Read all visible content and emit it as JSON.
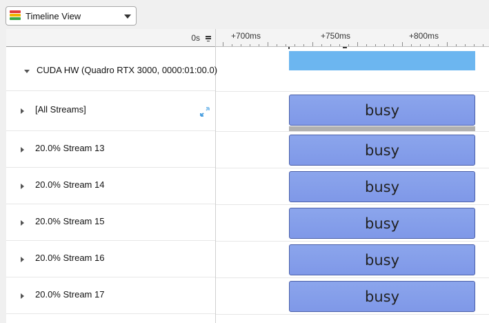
{
  "toolbar": {
    "view_selector": {
      "label": "Timeline View",
      "icon": "timeline-view-icon",
      "icon_colors": [
        "#e03c3c",
        "#f0b400",
        "#39a845",
        "#3a7fd5"
      ]
    }
  },
  "timeline": {
    "origin_label": "0s",
    "ruler": {
      "labels": [
        "+700ms",
        "+750ms",
        "+800ms"
      ]
    }
  },
  "rows": [
    {
      "label": "CUDA HW (Quadro RTX 3000, 0000:01:00.0)",
      "expanded": true
    },
    {
      "label": "[All Streams]",
      "expanded": false
    },
    {
      "label": "20.0% Stream 13",
      "expanded": false
    },
    {
      "label": "20.0% Stream 14",
      "expanded": false
    },
    {
      "label": "20.0% Stream 15",
      "expanded": false
    },
    {
      "label": "20.0% Stream 16",
      "expanded": false
    },
    {
      "label": "20.0% Stream 17",
      "expanded": false
    }
  ],
  "lanes": {
    "busy_label": "busy",
    "colors": {
      "hw_bar": "#6cb6f0",
      "busy_fill": "#8099ea",
      "busy_border": "#4a5fa8",
      "aggregate_strip": "#b0b0b0"
    }
  }
}
